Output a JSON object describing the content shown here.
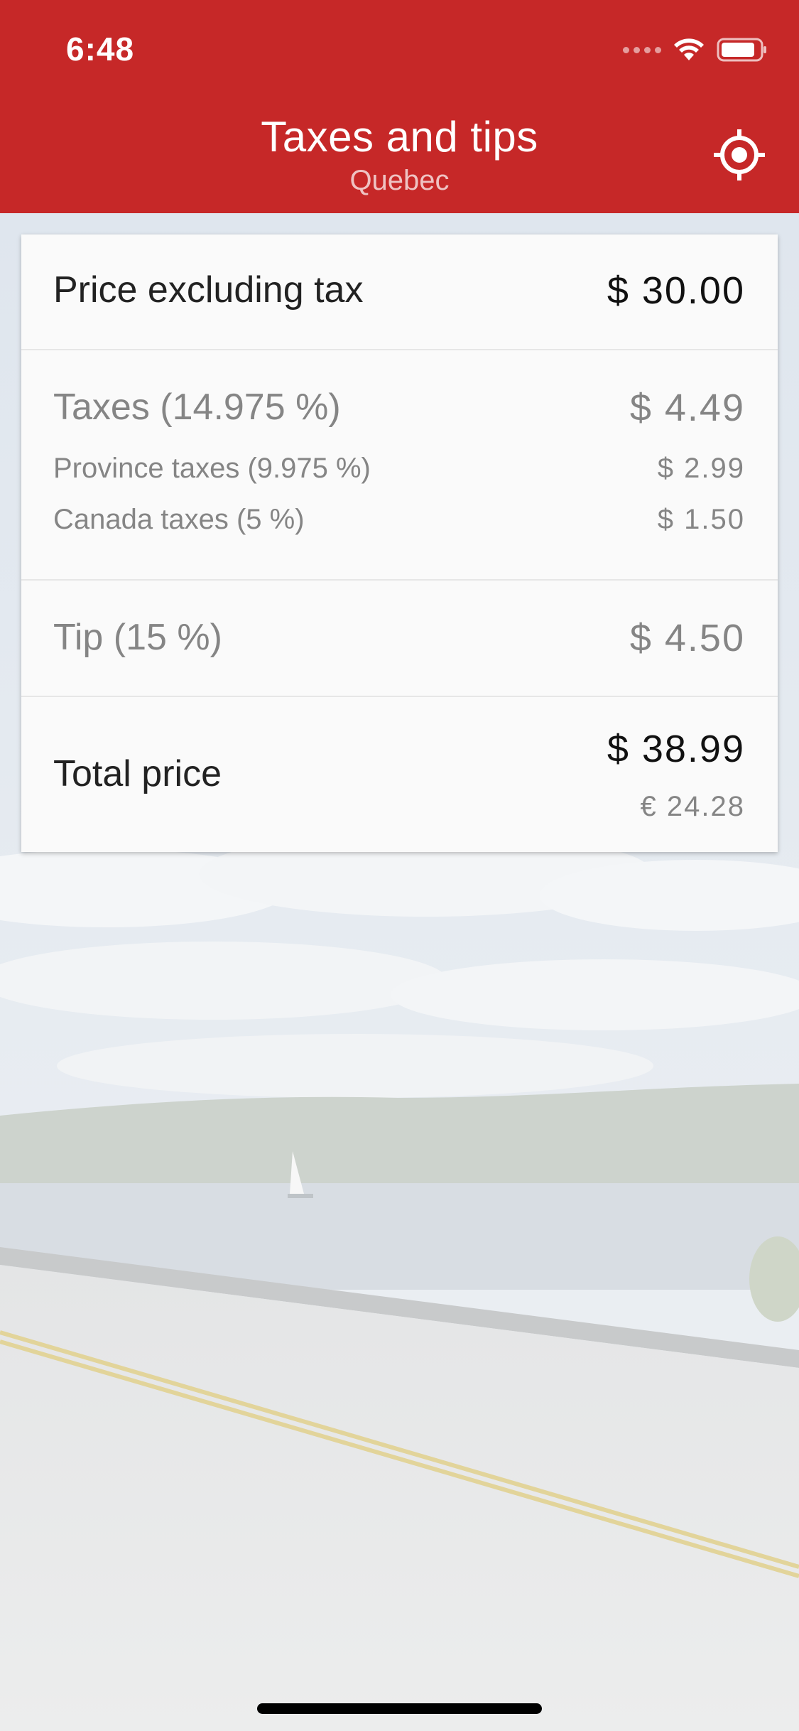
{
  "status_bar": {
    "time": "6:48"
  },
  "header": {
    "title": "Taxes and tips",
    "subtitle": "Quebec",
    "locate_icon": "crosshair-location-icon"
  },
  "card": {
    "price_excl_tax": {
      "label": "Price excluding tax",
      "value": "$ 30.00"
    },
    "taxes": {
      "label": "Taxes (14.975 %)",
      "value": "$ 4.49",
      "province": {
        "label": "Province taxes (9.975 %)",
        "value": "$ 2.99"
      },
      "canada": {
        "label": "Canada taxes (5 %)",
        "value": "$ 1.50"
      }
    },
    "tip": {
      "label": "Tip (15 %)",
      "value": "$ 4.50"
    },
    "total": {
      "label": "Total price",
      "value": "$ 38.99",
      "value_eur": "€ 24.28"
    }
  },
  "colors": {
    "header_bg": "#c62828",
    "card_bg": "#fafafa",
    "muted_text": "#858585"
  }
}
